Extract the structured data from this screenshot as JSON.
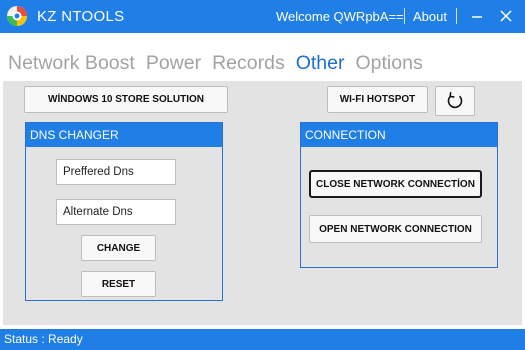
{
  "app": {
    "title": "KZ NTOOLS",
    "welcome": "Welcome QWRpbA==",
    "about_label": "About",
    "accent_color": "#1f7fe6",
    "icons": [
      "app-logo-icon",
      "minimize-icon",
      "close-icon",
      "refresh-icon"
    ]
  },
  "nav": {
    "tabs": [
      {
        "label": "Network Boost"
      },
      {
        "label": "Power"
      },
      {
        "label": "Records"
      },
      {
        "label": "Other",
        "active": true
      },
      {
        "label": "Options"
      }
    ]
  },
  "main": {
    "store_button": "WİNDOWS 10 STORE SOLUTION",
    "hotspot_button": "WI-FI HOTSPOT",
    "dns": {
      "title": "DNS CHANGER",
      "preferred_placeholder": "Preffered Dns",
      "alternate_placeholder": "Alternate Dns",
      "change_button": "CHANGE",
      "reset_button": "RESET"
    },
    "connection": {
      "title": "CONNECTION",
      "close_button": "CLOSE NETWORK CONNECTİON",
      "open_button": "OPEN NETWORK CONNECTION"
    }
  },
  "status": {
    "text": "Status : Ready"
  }
}
